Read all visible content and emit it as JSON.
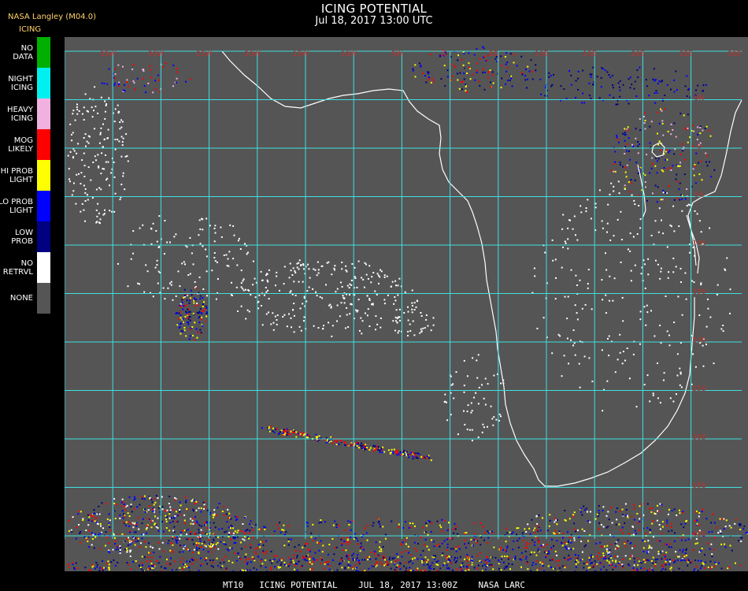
{
  "header": {
    "title": "ICING POTENTIAL",
    "time": "Jul 18, 2017 13:00 UTC",
    "producer": "NASA Langley (M04.0)",
    "product": "ICING"
  },
  "legend": [
    {
      "line1": "NO",
      "line2": "DATA",
      "color": "#00b000"
    },
    {
      "line1": "NIGHT",
      "line2": "ICING",
      "color": "#00f0f0"
    },
    {
      "line1": "HEAVY",
      "line2": "ICING",
      "color": "#f0b0e0"
    },
    {
      "line1": "MOG",
      "line2": "LIKELY",
      "color": "#ff0000"
    },
    {
      "line1": "HI PROB",
      "line2": "LIGHT",
      "color": "#ffff00"
    },
    {
      "line1": "LO PROB",
      "line2": "LIGHT",
      "color": "#0000ff"
    },
    {
      "line1": "LOW",
      "line2": "PROB",
      "color": "#000080"
    },
    {
      "line1": "NO",
      "line2": "RETRVL",
      "color": "#ffffff"
    },
    {
      "line1": "NONE",
      "line2": "",
      "color": "#555555"
    }
  ],
  "map": {
    "background": "#555555",
    "grid_color": "#40e0e0",
    "coast_color": "#ffffff",
    "label_color": "#c03030",
    "lon_labels": [
      "35W",
      "30W",
      "25W",
      "20W",
      "15W",
      "10W",
      "5W",
      "0",
      "5E",
      "10E",
      "15E",
      "20E",
      "25E",
      "30E"
    ],
    "lat_labels": [
      "5N",
      "0",
      "5S",
      "10S",
      "15S",
      "20S",
      "25S",
      "30S",
      "35S",
      "40S",
      "45S"
    ]
  },
  "footer": "MT10   ICING POTENTIAL    JUL 18, 2017 13:00Z    NASA LARC"
}
